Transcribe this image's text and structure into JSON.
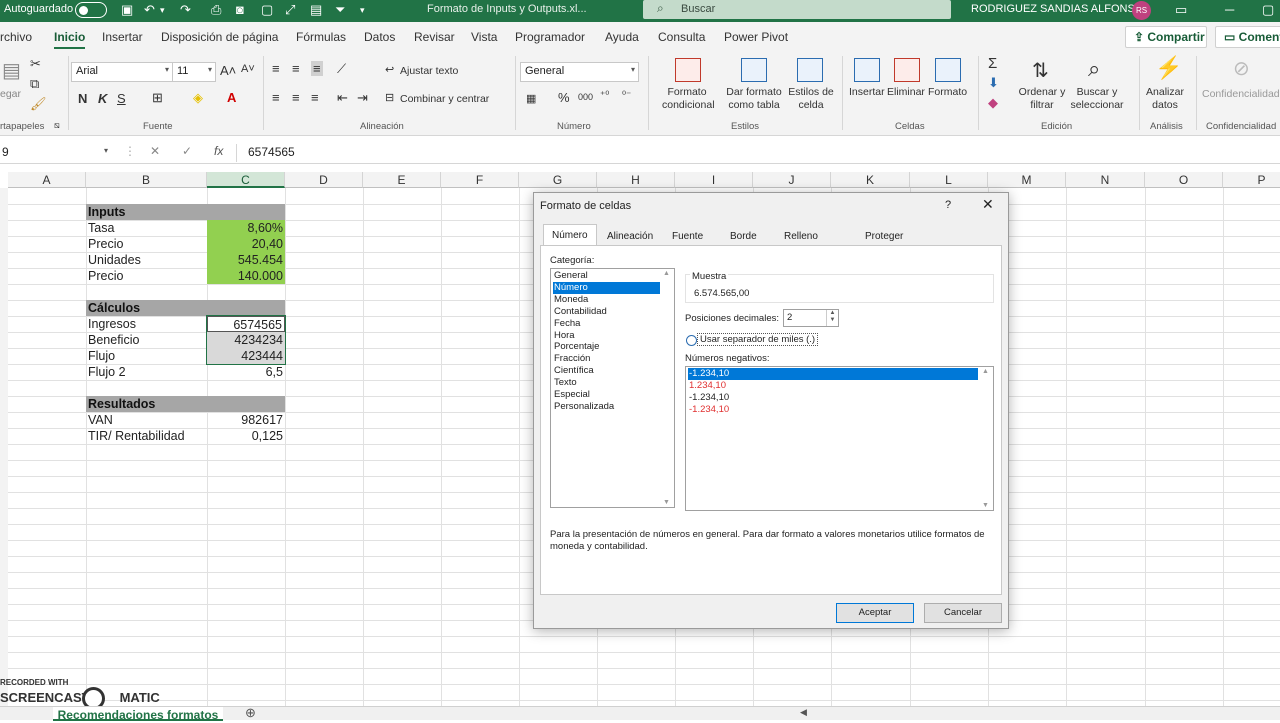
{
  "titlebar": {
    "autosave": "Autoguardado",
    "filename": "Formato de Inputs y Outputs.xl...",
    "search_placeholder": "Buscar",
    "user": "RODRIGUEZ SANDIAS ALFONSO",
    "initials": "RS"
  },
  "menu": {
    "tabs": [
      "rchivo",
      "Inicio",
      "Insertar",
      "Disposición de página",
      "Fórmulas",
      "Datos",
      "Revisar",
      "Vista",
      "Programador",
      "Ayuda",
      "Consulta",
      "Power Pivot"
    ],
    "share": "Compartir",
    "comments": "Comenta"
  },
  "ribbon": {
    "clipboard": {
      "paste": "egar",
      "label": "rtapapeles"
    },
    "font": {
      "name": "Arial",
      "size": "11",
      "label": "Fuente",
      "bold": "N",
      "italic": "K",
      "underline": "S"
    },
    "alignment": {
      "wrap": "Ajustar texto",
      "merge": "Combinar y centrar",
      "label": "Alineación"
    },
    "number": {
      "format": "General",
      "label": "Número",
      "percent": "%",
      "thousands": "000"
    },
    "styles": {
      "conditional": [
        "Formato",
        "condicional"
      ],
      "table": [
        "Dar formato",
        "como tabla"
      ],
      "cell": [
        "Estilos de",
        "celda"
      ],
      "label": "Estilos"
    },
    "cells": {
      "insert": "Insertar",
      "delete": "Eliminar",
      "format": "Formato",
      "label": "Celdas"
    },
    "editing": {
      "sort": [
        "Ordenar y",
        "filtrar"
      ],
      "find": [
        "Buscar y",
        "seleccionar"
      ],
      "label": "Edición"
    },
    "analysis": {
      "analyze": [
        "Analizar",
        "datos"
      ],
      "label": "Análisis"
    },
    "sensitivity": {
      "label": "Confidencialidad",
      "button": "Confidencialidad"
    }
  },
  "formula_bar": {
    "namebox": "9",
    "value": "6574565",
    "fx": "fx"
  },
  "columns": [
    "A",
    "B",
    "C",
    "D",
    "E",
    "F",
    "G",
    "H",
    "I",
    "J",
    "K",
    "L",
    "M",
    "N",
    "O",
    "P"
  ],
  "sheet": {
    "inputs_header": "Inputs",
    "inputs": [
      {
        "label": "Tasa",
        "value": "8,60%"
      },
      {
        "label": "Precio",
        "value": "20,40"
      },
      {
        "label": "Unidades",
        "value": "545.454"
      },
      {
        "label": "Precio",
        "value": "140.000"
      }
    ],
    "calc_header": "Cálculos",
    "calcs": [
      {
        "label": "Ingresos",
        "value": "6574565"
      },
      {
        "label": "Beneficio",
        "value": "4234234"
      },
      {
        "label": "Flujo",
        "value": "423444"
      },
      {
        "label": "Flujo 2",
        "value": "6,5"
      }
    ],
    "results_header": "Resultados",
    "results": [
      {
        "label": "VAN",
        "value": "982617"
      },
      {
        "label": "TIR/ Rentabilidad",
        "value": "0,125"
      }
    ]
  },
  "dialog": {
    "title": "Formato de celdas",
    "help": "?",
    "close": "✕",
    "tabs": [
      "Número",
      "Alineación",
      "Fuente",
      "Borde",
      "Relleno",
      "Proteger"
    ],
    "category_label": "Categoría:",
    "categories": [
      "General",
      "Número",
      "Moneda",
      "Contabilidad",
      "Fecha",
      "Hora",
      "Porcentaje",
      "Fracción",
      "Científica",
      "Texto",
      "Especial",
      "Personalizada"
    ],
    "selected_category": "Número",
    "sample_label": "Muestra",
    "sample_value": "6.574.565,00",
    "decimals_label": "Posiciones decimales:",
    "decimals_value": "2",
    "thousands_label": "Usar separador de miles (.)",
    "thousands_checked": false,
    "negative_label": "Números negativos:",
    "negatives": [
      "-1.234,10",
      "1.234,10",
      "-1.234,10",
      "-1.234,10"
    ],
    "description": "Para la presentación de números en general. Para dar formato a valores monetarios utilice formatos de moneda y contabilidad.",
    "ok": "Aceptar",
    "cancel": "Cancelar"
  },
  "statusbar": {
    "sheet_tab": "Recomendaciones formatos",
    "add": "⊕"
  },
  "watermark": {
    "top": "RECORDED WITH",
    "brand": "SCREENCAST",
    "brand2": "MATIC"
  }
}
